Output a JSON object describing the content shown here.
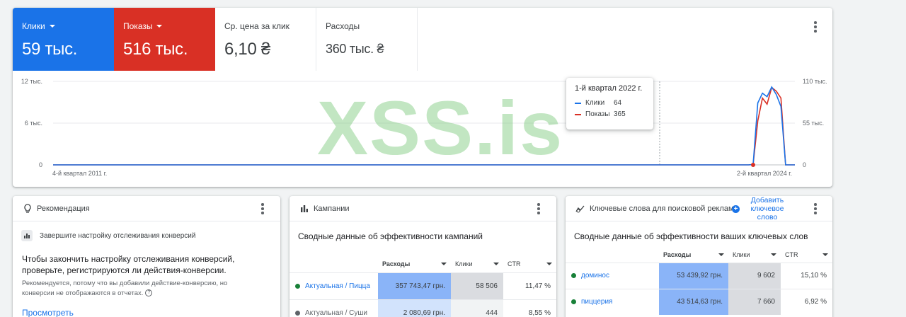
{
  "overview": {
    "metrics": [
      {
        "label": "Клики",
        "value": "59 тыс."
      },
      {
        "label": "Показы",
        "value": "516 тыс."
      },
      {
        "label": "Ср. цена за клик",
        "value": "6,10 ₴"
      },
      {
        "label": "Расходы",
        "value": "360 тыс. ₴"
      }
    ]
  },
  "colors": {
    "clicks": "#1a73e8",
    "impressions": "#d93025"
  },
  "chart_data": {
    "type": "line",
    "x_start_label": "4-й квартал 2011 г.",
    "x_end_label": "2-й квартал 2024 г.",
    "y_left_ticks": [
      "12 тыс.",
      "6 тыс.",
      "0"
    ],
    "y_right_ticks": [
      "110 тыс.",
      "55 тыс.",
      "0"
    ],
    "ylim_left": [
      0,
      12000
    ],
    "ylim_right": [
      0,
      110000
    ],
    "series": [
      {
        "name": "Клики",
        "axis": "left",
        "values": [
          0,
          0,
          0,
          0,
          0,
          0,
          0,
          0,
          0,
          0,
          0,
          0,
          0,
          0,
          0,
          0,
          0,
          0,
          0,
          0,
          0,
          0,
          0,
          0,
          0,
          0,
          0,
          0,
          0,
          0,
          0,
          0,
          0,
          0,
          0,
          0,
          0,
          0,
          0,
          0,
          0,
          0,
          0,
          0,
          0,
          0,
          0,
          0,
          0,
          0,
          0,
          0,
          0,
          0,
          0,
          0,
          0,
          0,
          0,
          0,
          0,
          0,
          0,
          0,
          0,
          0,
          0,
          0,
          0,
          0,
          0,
          0,
          0,
          0,
          0,
          0,
          0,
          0,
          0,
          0,
          0,
          0,
          0,
          0,
          0,
          0,
          0,
          0,
          0,
          0,
          0,
          0,
          0,
          0,
          0,
          0,
          0,
          0,
          0,
          0,
          0,
          0,
          0,
          0,
          0,
          0,
          0,
          0,
          0,
          0,
          0,
          0,
          0,
          0,
          0,
          0,
          0,
          0,
          0,
          0,
          0,
          0,
          0,
          0,
          0,
          0,
          0,
          0,
          0,
          0,
          0,
          0,
          0,
          0,
          0,
          0,
          0,
          0,
          0,
          0,
          0,
          0,
          0,
          0,
          0,
          0,
          0,
          0,
          0,
          0,
          0,
          64,
          8900,
          10300,
          9800,
          11200,
          10100,
          8400,
          0,
          0,
          0
        ]
      },
      {
        "name": "Показы",
        "axis": "right",
        "values": [
          0,
          0,
          0,
          0,
          0,
          0,
          0,
          0,
          0,
          0,
          0,
          0,
          0,
          0,
          0,
          0,
          0,
          0,
          0,
          0,
          0,
          0,
          0,
          0,
          0,
          0,
          0,
          0,
          0,
          0,
          0,
          0,
          0,
          0,
          0,
          0,
          0,
          0,
          0,
          0,
          0,
          0,
          0,
          0,
          0,
          0,
          0,
          0,
          0,
          0,
          0,
          0,
          0,
          0,
          0,
          0,
          0,
          0,
          0,
          0,
          0,
          0,
          0,
          0,
          0,
          0,
          0,
          0,
          0,
          0,
          0,
          0,
          0,
          0,
          0,
          0,
          0,
          0,
          0,
          0,
          0,
          0,
          0,
          0,
          0,
          0,
          0,
          0,
          0,
          0,
          0,
          0,
          0,
          0,
          0,
          0,
          0,
          0,
          0,
          0,
          0,
          0,
          0,
          0,
          0,
          0,
          0,
          0,
          0,
          0,
          0,
          0,
          0,
          0,
          0,
          0,
          0,
          0,
          0,
          0,
          0,
          0,
          0,
          0,
          0,
          0,
          0,
          0,
          0,
          0,
          0,
          0,
          0,
          0,
          0,
          0,
          0,
          0,
          0,
          0,
          0,
          0,
          0,
          0,
          0,
          0,
          0,
          0,
          0,
          0,
          0,
          365,
          58000,
          88000,
          80000,
          102000,
          97000,
          88000,
          0,
          0,
          0
        ]
      }
    ],
    "tooltip": {
      "title": "1-й квартал 2022 г.",
      "rows": [
        {
          "name": "Клики",
          "value": "64"
        },
        {
          "name": "Показы",
          "value": "365"
        }
      ]
    }
  },
  "watermark": "XSS.is",
  "recommendation": {
    "header": "Рекомендация",
    "task": "Завершите настройку отслеживания конверсий",
    "title": "Чтобы закончить настройку отслеживания конверсий, проверьте, регистрируются ли действия-конверсии.",
    "note": "Рекомендуется, потому что вы добавили действие-конверсию, но конверсии не отображаются в отчетах.",
    "link": "Просмотреть"
  },
  "campaigns": {
    "header": "Кампании",
    "title": "Сводные данные об эффективности кампаний",
    "columns": [
      "Расходы",
      "Клики",
      "CTR"
    ],
    "rows": [
      {
        "name": "Актуальная / Пицца",
        "cost": "357 743,47 грн.",
        "clicks": "58 506",
        "ctr": "11,47 %",
        "status": "green"
      },
      {
        "name": "Актуальная / Суши",
        "cost": "2 080,69 грн.",
        "clicks": "444",
        "ctr": "8,55 %",
        "status": "grey"
      }
    ]
  },
  "keywords": {
    "header": "Ключевые слова для поисковой рекламы",
    "add_label": "Добавить ключевое слово",
    "title": "Сводные данные об эффективности ваших ключевых слов",
    "columns": [
      "Расходы",
      "Клики",
      "CTR"
    ],
    "rows": [
      {
        "name": "доминос",
        "cost": "53 439,92 грн.",
        "clicks": "9 602",
        "ctr": "15,10 %"
      },
      {
        "name": "пиццерия",
        "cost": "43 514,63 грн.",
        "clicks": "7 660",
        "ctr": "6,92 %"
      }
    ]
  }
}
